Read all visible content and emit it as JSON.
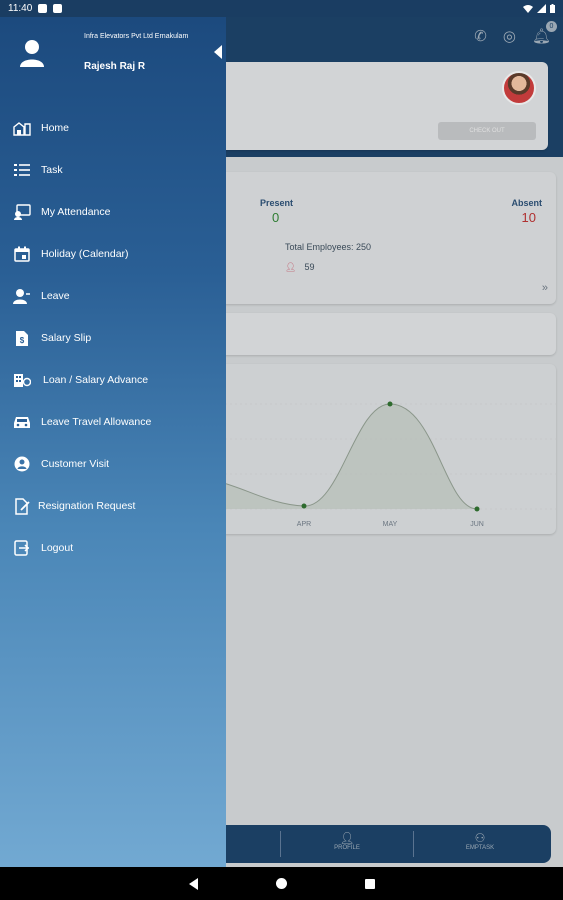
{
  "status_bar": {
    "time": "11:40",
    "battery_icon": "battery-icon",
    "wifi_icon": "wifi-icon",
    "signal_icon": "signal-icon"
  },
  "drawer": {
    "company": "Infra Elevators Pvt Ltd Ernakulam",
    "user_name": "Rajesh Raj R",
    "items": [
      {
        "label": "Home",
        "icon": "home-icon"
      },
      {
        "label": "Task",
        "icon": "task-list-icon"
      },
      {
        "label": "My Attendance",
        "icon": "attendance-icon"
      },
      {
        "label": "Holiday (Calendar)",
        "icon": "calendar-icon"
      },
      {
        "label": "Leave",
        "icon": "leave-icon"
      },
      {
        "label": "Salary Slip",
        "icon": "salary-slip-icon"
      },
      {
        "label": "Loan / Salary Advance",
        "icon": "loan-icon"
      },
      {
        "label": "Leave Travel Allowance",
        "icon": "car-icon"
      },
      {
        "label": "Customer Visit",
        "icon": "customer-visit-icon"
      },
      {
        "label": "Resignation Request",
        "icon": "resignation-icon"
      },
      {
        "label": "Logout",
        "icon": "logout-icon"
      }
    ]
  },
  "background": {
    "profile_card": {
      "button_label": "CHECK OUT"
    },
    "attendance": {
      "present_label": "Present",
      "present_value": "0",
      "absent_label": "Absent",
      "absent_value": "10",
      "total_employees": "Total Employees: 250",
      "users_count": "59"
    },
    "chart_labels": [
      "APR",
      "MAY",
      "JUN"
    ],
    "bottom_nav": [
      {
        "label": "PROFILE"
      },
      {
        "label": "EMPTASK"
      }
    ]
  },
  "colors": {
    "drawer_top": "#1c4a7e",
    "drawer_bottom": "#72a9d2",
    "present": "#2e7d32",
    "absent": "#b03030"
  }
}
